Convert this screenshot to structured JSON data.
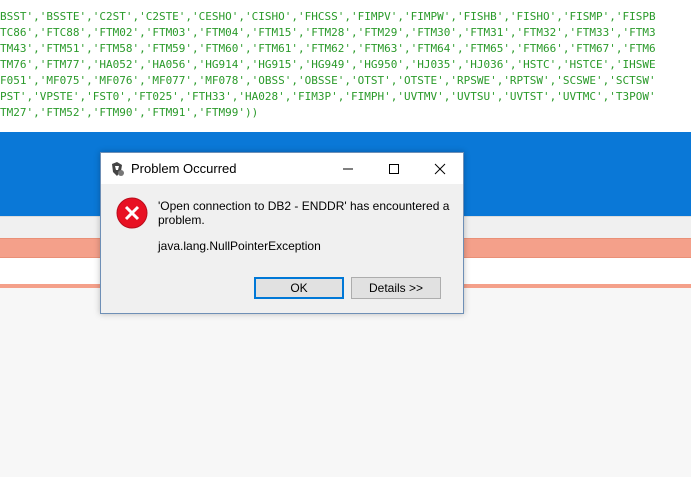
{
  "code_lines": [
    "BSST','BSSTE','C2ST','C2STE','CESHO','CISHO','FHCSS','FIMPV','FIMPW','FISHB','FISHO','FISMP','FISPB",
    "TC86','FTC88','FTM02','FTM03','FTM04','FTM15','FTM28','FTM29','FTM30','FTM31','FTM32','FTM33','FTM3",
    "TM43','FTM51','FTM58','FTM59','FTM60','FTM61','FTM62','FTM63','FTM64','FTM65','FTM66','FTM67','FTM6",
    "TM76','FTM77','HA052','HA056','HG914','HG915','HG949','HG950','HJ035','HJ036','HSTC','HSTCE','IHSWE",
    "F051','MF075','MF076','MF077','MF078','OBSS','OBSSE','OTST','OTSTE','RPSWE','RPTSW','SCSWE','SCTSW'",
    "PST','VPSTE','FST0','FT025','FTH33','HA028','FIM3P','FIMPH','UVTMV','UVTSU','UVTST','UVTMC','T3POW'",
    "TM27','FTM52','FTM90','FTM91','FTM99'))"
  ],
  "dialog": {
    "title": "Problem Occurred",
    "message": "'Open connection to DB2 - ENDDR' has encountered a problem.",
    "detail": "java.lang.NullPointerException",
    "ok_label": "OK",
    "details_label": "Details >>",
    "icon": "error-icon"
  },
  "colors": {
    "code_text": "#2a9a2a",
    "blue_band": "#0a78d7",
    "salmon_band": "#f4a08a",
    "error_red": "#e81123"
  }
}
